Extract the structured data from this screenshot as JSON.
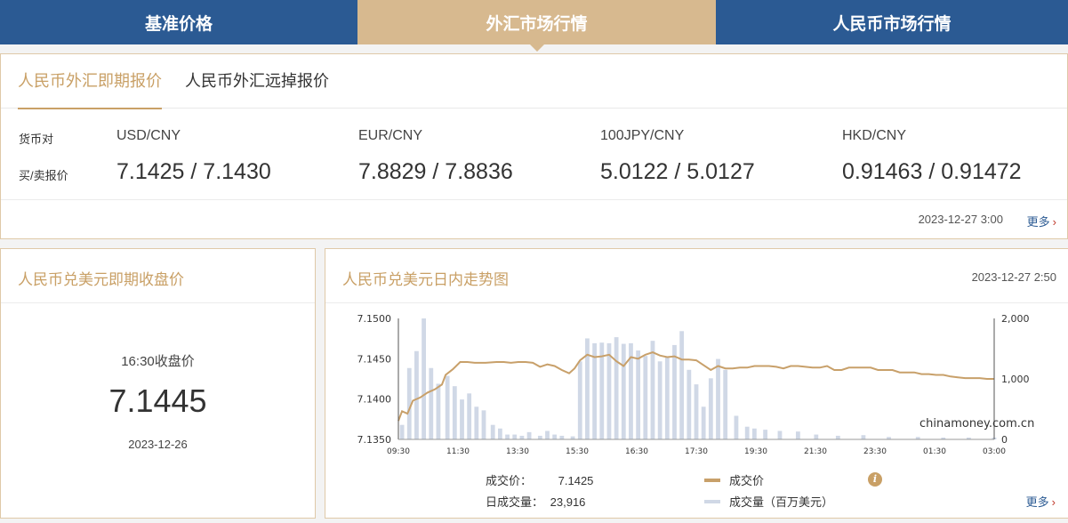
{
  "top_tabs": [
    "基准价格",
    "外汇市场行情",
    "人民币市场行情"
  ],
  "quote": {
    "tabs": [
      "人民币外汇即期报价",
      "人民币外汇远掉报价"
    ],
    "row_labels": {
      "pair": "货币对",
      "price": "买/卖报价"
    },
    "pairs": [
      {
        "pair": "USD/CNY",
        "price": "7.1425 / 7.1430"
      },
      {
        "pair": "EUR/CNY",
        "price": "7.8829 / 7.8836"
      },
      {
        "pair": "100JPY/CNY",
        "price": "5.0122 / 5.0127"
      },
      {
        "pair": "HKD/CNY",
        "price": "0.91463 / 0.91472"
      }
    ],
    "timestamp": "2023-12-27 3:00",
    "more": "更多"
  },
  "closing": {
    "title": "人民币兑美元即期收盘价",
    "label": "16:30收盘价",
    "value": "7.1445",
    "date": "2023-12-26"
  },
  "trend": {
    "title": "人民币兑美元日内走势图",
    "timestamp": "2023-12-27 2:50",
    "watermark": "chinamoney.com.cn",
    "stats": {
      "price_label": "成交价：",
      "price_value": "7.1425",
      "volume_label": "日成交量：",
      "volume_value": "23,916"
    },
    "legend": {
      "price": "成交价",
      "volume": "成交量（百万美元）"
    },
    "more": "更多",
    "colors": {
      "price": "#c8a06a",
      "volume": "#d0d8e6",
      "accent": "#c9a066",
      "nav": "#2b5a93"
    }
  },
  "chart_data": {
    "type": "line",
    "x_ticks": [
      "09:30",
      "11:30",
      "13:30",
      "15:30",
      "16:30",
      "17:30",
      "19:30",
      "21:30",
      "23:30",
      "01:30",
      "03:00"
    ],
    "y_ticks": [
      "7.1500",
      "7.1450",
      "7.1400",
      "7.1350"
    ],
    "ylim": [
      7.135,
      7.15
    ],
    "y2_ticks": [
      "2,000",
      "1,000",
      "0"
    ],
    "y2lim": [
      0,
      2000
    ],
    "price_series": {
      "name": "成交价",
      "t": [
        0,
        0.02,
        0.05,
        0.08,
        0.12,
        0.16,
        0.2,
        0.24,
        0.26,
        0.3,
        0.34,
        0.38,
        0.42,
        0.48,
        0.54,
        0.58,
        0.62,
        0.66,
        0.7,
        0.74,
        0.78,
        0.82,
        0.86,
        0.9,
        0.94,
        0.97,
        1.0,
        1.04,
        1.08,
        1.12,
        1.16,
        1.2,
        1.24,
        1.28,
        1.32,
        1.36,
        1.4,
        1.44,
        1.48,
        1.52,
        1.56,
        1.6,
        1.64,
        1.68,
        1.72,
        1.76,
        1.8,
        1.84,
        1.88,
        1.92,
        1.96,
        2.0,
        2.04,
        2.08,
        2.12,
        2.16,
        2.2,
        2.24,
        2.28,
        2.32,
        2.36,
        2.4,
        2.44,
        2.48,
        2.52,
        2.56,
        2.6,
        2.64,
        2.68,
        2.72,
        2.76,
        2.8,
        2.84,
        2.88,
        2.92,
        2.96,
        3.0,
        3.04,
        3.08,
        3.12,
        3.16,
        3.2,
        3.24,
        3.28
      ],
      "values": [
        7.1373,
        7.1385,
        7.1382,
        7.1398,
        7.1402,
        7.1408,
        7.1412,
        7.1418,
        7.143,
        7.1437,
        7.1446,
        7.1446,
        7.1445,
        7.1445,
        7.1446,
        7.1446,
        7.1445,
        7.1446,
        7.1446,
        7.1445,
        7.144,
        7.1443,
        7.1441,
        7.1436,
        7.1432,
        7.1438,
        7.1448,
        7.1455,
        7.1452,
        7.1453,
        7.1455,
        7.1447,
        7.1441,
        7.1452,
        7.145,
        7.1455,
        7.1458,
        7.1454,
        7.1452,
        7.1453,
        7.1449,
        7.1449,
        7.1448,
        7.1442,
        7.1436,
        7.1441,
        7.1438,
        7.1438,
        7.1439,
        7.1439,
        7.1441,
        7.1441,
        7.1441,
        7.144,
        7.1438,
        7.1441,
        7.1441,
        7.144,
        7.1439,
        7.1439,
        7.1441,
        7.1436,
        7.1436,
        7.1439,
        7.1439,
        7.1439,
        7.1439,
        7.1436,
        7.1436,
        7.1436,
        7.1433,
        7.1433,
        7.1433,
        7.1431,
        7.1431,
        7.143,
        7.143,
        7.1428,
        7.1427,
        7.1426,
        7.1426,
        7.1426,
        7.1425,
        7.1425
      ]
    },
    "volume_series": {
      "name": "成交量（百万美元）",
      "t": [
        0.02,
        0.06,
        0.1,
        0.14,
        0.18,
        0.22,
        0.27,
        0.31,
        0.35,
        0.39,
        0.43,
        0.47,
        0.52,
        0.56,
        0.6,
        0.64,
        0.68,
        0.72,
        0.78,
        0.82,
        0.86,
        0.9,
        0.96,
        1.0,
        1.04,
        1.08,
        1.12,
        1.16,
        1.2,
        1.24,
        1.28,
        1.32,
        1.36,
        1.4,
        1.44,
        1.48,
        1.52,
        1.56,
        1.6,
        1.64,
        1.68,
        1.72,
        1.76,
        1.8,
        1.86,
        1.92,
        1.96,
        2.02,
        2.1,
        2.2,
        2.3,
        2.42,
        2.56,
        2.7,
        2.86,
        3.0,
        3.14,
        3.28
      ],
      "values": [
        240,
        1180,
        1460,
        2000,
        1180,
        920,
        1050,
        880,
        660,
        760,
        540,
        480,
        240,
        180,
        80,
        80,
        60,
        120,
        60,
        140,
        80,
        60,
        50,
        1290,
        1670,
        1590,
        1600,
        1590,
        1690,
        1580,
        1590,
        1470,
        1380,
        1630,
        1290,
        1370,
        1560,
        1790,
        1150,
        910,
        540,
        1010,
        1330,
        1150,
        390,
        210,
        180,
        160,
        140,
        130,
        80,
        60,
        70,
        40,
        40,
        30,
        30,
        30
      ]
    }
  }
}
